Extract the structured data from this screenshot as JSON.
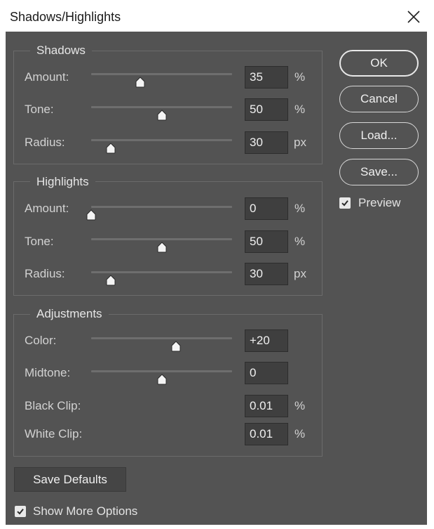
{
  "window": {
    "title": "Shadows/Highlights",
    "close_icon": "close-icon"
  },
  "shadows": {
    "legend": "Shadows",
    "amount": {
      "label": "Amount:",
      "value": "35",
      "unit": "%",
      "slider_fraction": 0.35
    },
    "tone": {
      "label": "Tone:",
      "value": "50",
      "unit": "%",
      "slider_fraction": 0.5
    },
    "radius": {
      "label": "Radius:",
      "value": "30",
      "unit": "px",
      "slider_fraction": 0.14
    }
  },
  "highlights": {
    "legend": "Highlights",
    "amount": {
      "label": "Amount:",
      "value": "0",
      "unit": "%",
      "slider_fraction": 0.0
    },
    "tone": {
      "label": "Tone:",
      "value": "50",
      "unit": "%",
      "slider_fraction": 0.5
    },
    "radius": {
      "label": "Radius:",
      "value": "30",
      "unit": "px",
      "slider_fraction": 0.14
    }
  },
  "adjustments": {
    "legend": "Adjustments",
    "color": {
      "label": "Color:",
      "value": "+20",
      "slider_fraction": 0.6
    },
    "midtone": {
      "label": "Midtone:",
      "value": "0",
      "slider_fraction": 0.5
    },
    "black_clip": {
      "label": "Black Clip:",
      "value": "0.01",
      "unit": "%"
    },
    "white_clip": {
      "label": "White Clip:",
      "value": "0.01",
      "unit": "%"
    }
  },
  "buttons": {
    "ok": "OK",
    "cancel": "Cancel",
    "load": "Load...",
    "save": "Save...",
    "save_defaults": "Save Defaults"
  },
  "preview": {
    "label": "Preview",
    "checked": true
  },
  "show_more": {
    "label": "Show More Options",
    "checked": true
  },
  "colors": {
    "panel": "#535353",
    "input_bg": "#3f3f3f",
    "text": "#d2d2d2",
    "track": "#6e6e6e"
  }
}
